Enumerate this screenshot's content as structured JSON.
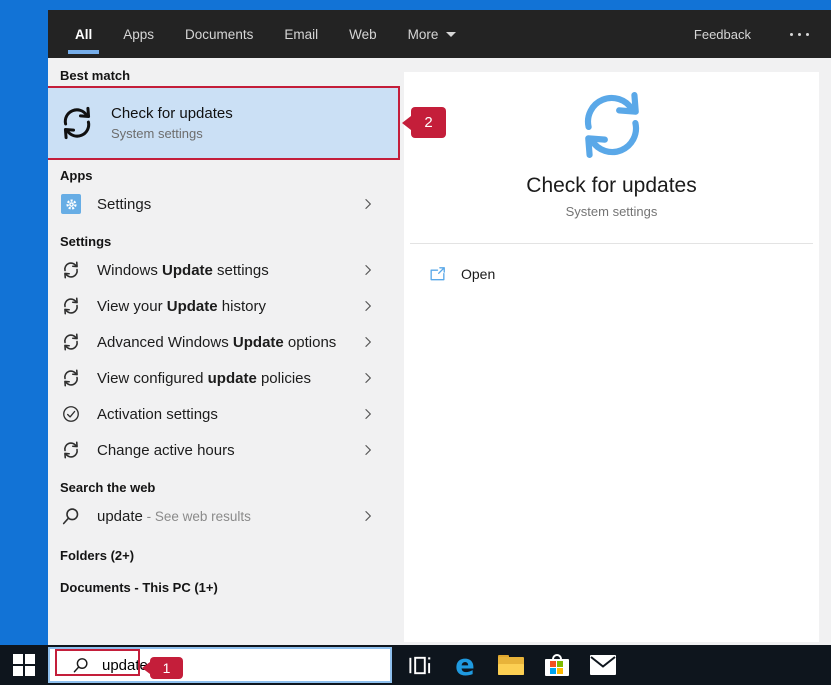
{
  "tab_bar": {
    "tabs": [
      {
        "label": "All",
        "active": true
      },
      {
        "label": "Apps"
      },
      {
        "label": "Documents"
      },
      {
        "label": "Email"
      },
      {
        "label": "Web"
      },
      {
        "label": "More",
        "caret": true
      }
    ],
    "feedback_label": "Feedback",
    "more_options_icon": "ellipsis-icon"
  },
  "left_panel": {
    "best_match": {
      "header": "Best match",
      "icon": "sync-icon",
      "title_parts": [
        {
          "t": "Check for "
        },
        {
          "t": "updates",
          "b": true
        }
      ],
      "subtitle": "System settings"
    },
    "sections": [
      {
        "header": "Apps",
        "items": [
          {
            "icon": "settings-gear-icon",
            "tile": true,
            "parts": [
              {
                "t": "Settings"
              }
            ],
            "chevron": true
          }
        ]
      },
      {
        "header": "Settings",
        "items": [
          {
            "icon": "sync-icon",
            "parts": [
              {
                "t": "Windows "
              },
              {
                "t": "Update",
                "b": true
              },
              {
                "t": " settings"
              }
            ],
            "chevron": true
          },
          {
            "icon": "sync-icon",
            "parts": [
              {
                "t": "View your "
              },
              {
                "t": "Update",
                "b": true
              },
              {
                "t": " history"
              }
            ],
            "chevron": true
          },
          {
            "icon": "sync-icon",
            "parts": [
              {
                "t": "Advanced Windows "
              },
              {
                "t": "Update",
                "b": true
              },
              {
                "t": " options"
              }
            ],
            "chevron": true
          },
          {
            "icon": "sync-icon",
            "parts": [
              {
                "t": "View configured "
              },
              {
                "t": "update",
                "b": true
              },
              {
                "t": " policies"
              }
            ],
            "chevron": true
          },
          {
            "icon": "checkmark-circle-icon",
            "parts": [
              {
                "t": "Activation settings"
              }
            ],
            "chevron": true
          },
          {
            "icon": "sync-icon",
            "parts": [
              {
                "t": "Change active hours"
              }
            ],
            "chevron": true
          }
        ]
      },
      {
        "header": "Search the web",
        "items": [
          {
            "icon": "search-icon",
            "parts": [
              {
                "t": "update"
              },
              {
                "t": " - See web results",
                "muted": true
              }
            ],
            "chevron": true
          }
        ]
      },
      {
        "header": "Folders (2+)",
        "items": []
      },
      {
        "header": "Documents - This PC (1+)",
        "items": []
      }
    ]
  },
  "preview_panel": {
    "icon": "sync-icon",
    "title": "Check for updates",
    "subtitle": "System settings",
    "actions": [
      {
        "icon": "open-external-icon",
        "label": "Open"
      }
    ]
  },
  "taskbar": {
    "search": {
      "value": "update",
      "icon": "search-icon"
    },
    "buttons": [
      "start-button",
      "task-view-button",
      "edge-browser-button",
      "file-explorer-button",
      "microsoft-store-button",
      "mail-button"
    ]
  },
  "annotations": {
    "badge_1": "1",
    "badge_2": "2"
  },
  "colors": {
    "desktop_blue": "#1273d6",
    "annotation_red": "#c41e3a",
    "highlight_blue": "#cbe0f5",
    "icon_blue": "#5aa8e8",
    "store_tile_red": "#f25022",
    "store_tile_green": "#7fba00",
    "store_tile_blue": "#00a4ef",
    "store_tile_yellow": "#ffb900"
  }
}
